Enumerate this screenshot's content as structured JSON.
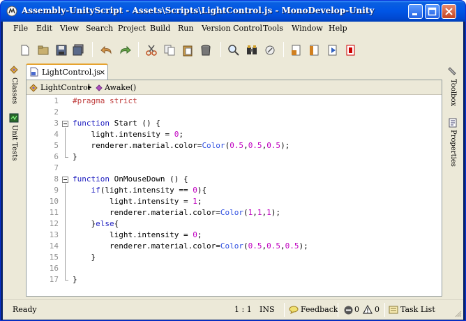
{
  "window": {
    "title": "Assembly-UnityScript - Assets\\Scripts\\LightControl.js - MonoDevelop-Unity"
  },
  "menu": [
    "File",
    "Edit",
    "View",
    "Search",
    "Project",
    "Build",
    "Run",
    "Version Control",
    "Tools",
    "Window",
    "Help"
  ],
  "toolbar": {
    "icons": [
      "new-file-icon",
      "open-icon",
      "save-icon",
      "save-all-icon",
      "undo-icon",
      "redo-icon",
      "cut-icon",
      "copy-icon",
      "paste-icon",
      "delete-icon",
      "find-icon",
      "find-in-files-icon",
      "replace-icon",
      "build-icon",
      "run-icon",
      "debug-icon",
      "stop-icon"
    ]
  },
  "side_pads": {
    "left": [
      "Classes",
      "Unit Tests"
    ],
    "right": [
      "Toolbox",
      "Properties"
    ]
  },
  "document_tab": {
    "label": "LightControl.js",
    "close": "×"
  },
  "breadcrumb": {
    "class": "LightControl",
    "separator": "▸",
    "method": "Awake()"
  },
  "code_lines": [
    "#pragma strict",
    "",
    "function Start () {",
    "    light.intensity = 0;",
    "    renderer.material.color=Color(0.5,0.5,0.5);",
    "}",
    "",
    "function OnMouseDown () {",
    "    if(light.intensity == 0){",
    "        light.intensity = 1;",
    "        renderer.material.color=Color(1,1,1);",
    "    }else{",
    "        light.intensity = 0;",
    "        renderer.material.color=Color(0.5,0.5,0.5);",
    "    }",
    "",
    "}"
  ],
  "line_numbers": [
    "1",
    "2",
    "3",
    "4",
    "5",
    "6",
    "7",
    "8",
    "9",
    "10",
    "11",
    "12",
    "13",
    "14",
    "15",
    "16",
    "17"
  ],
  "status": {
    "state": "Ready",
    "position": "1 : 1",
    "mode": "INS",
    "feedback": "Feedback",
    "errors": "0",
    "warnings": "0",
    "task_list": "Task List"
  }
}
